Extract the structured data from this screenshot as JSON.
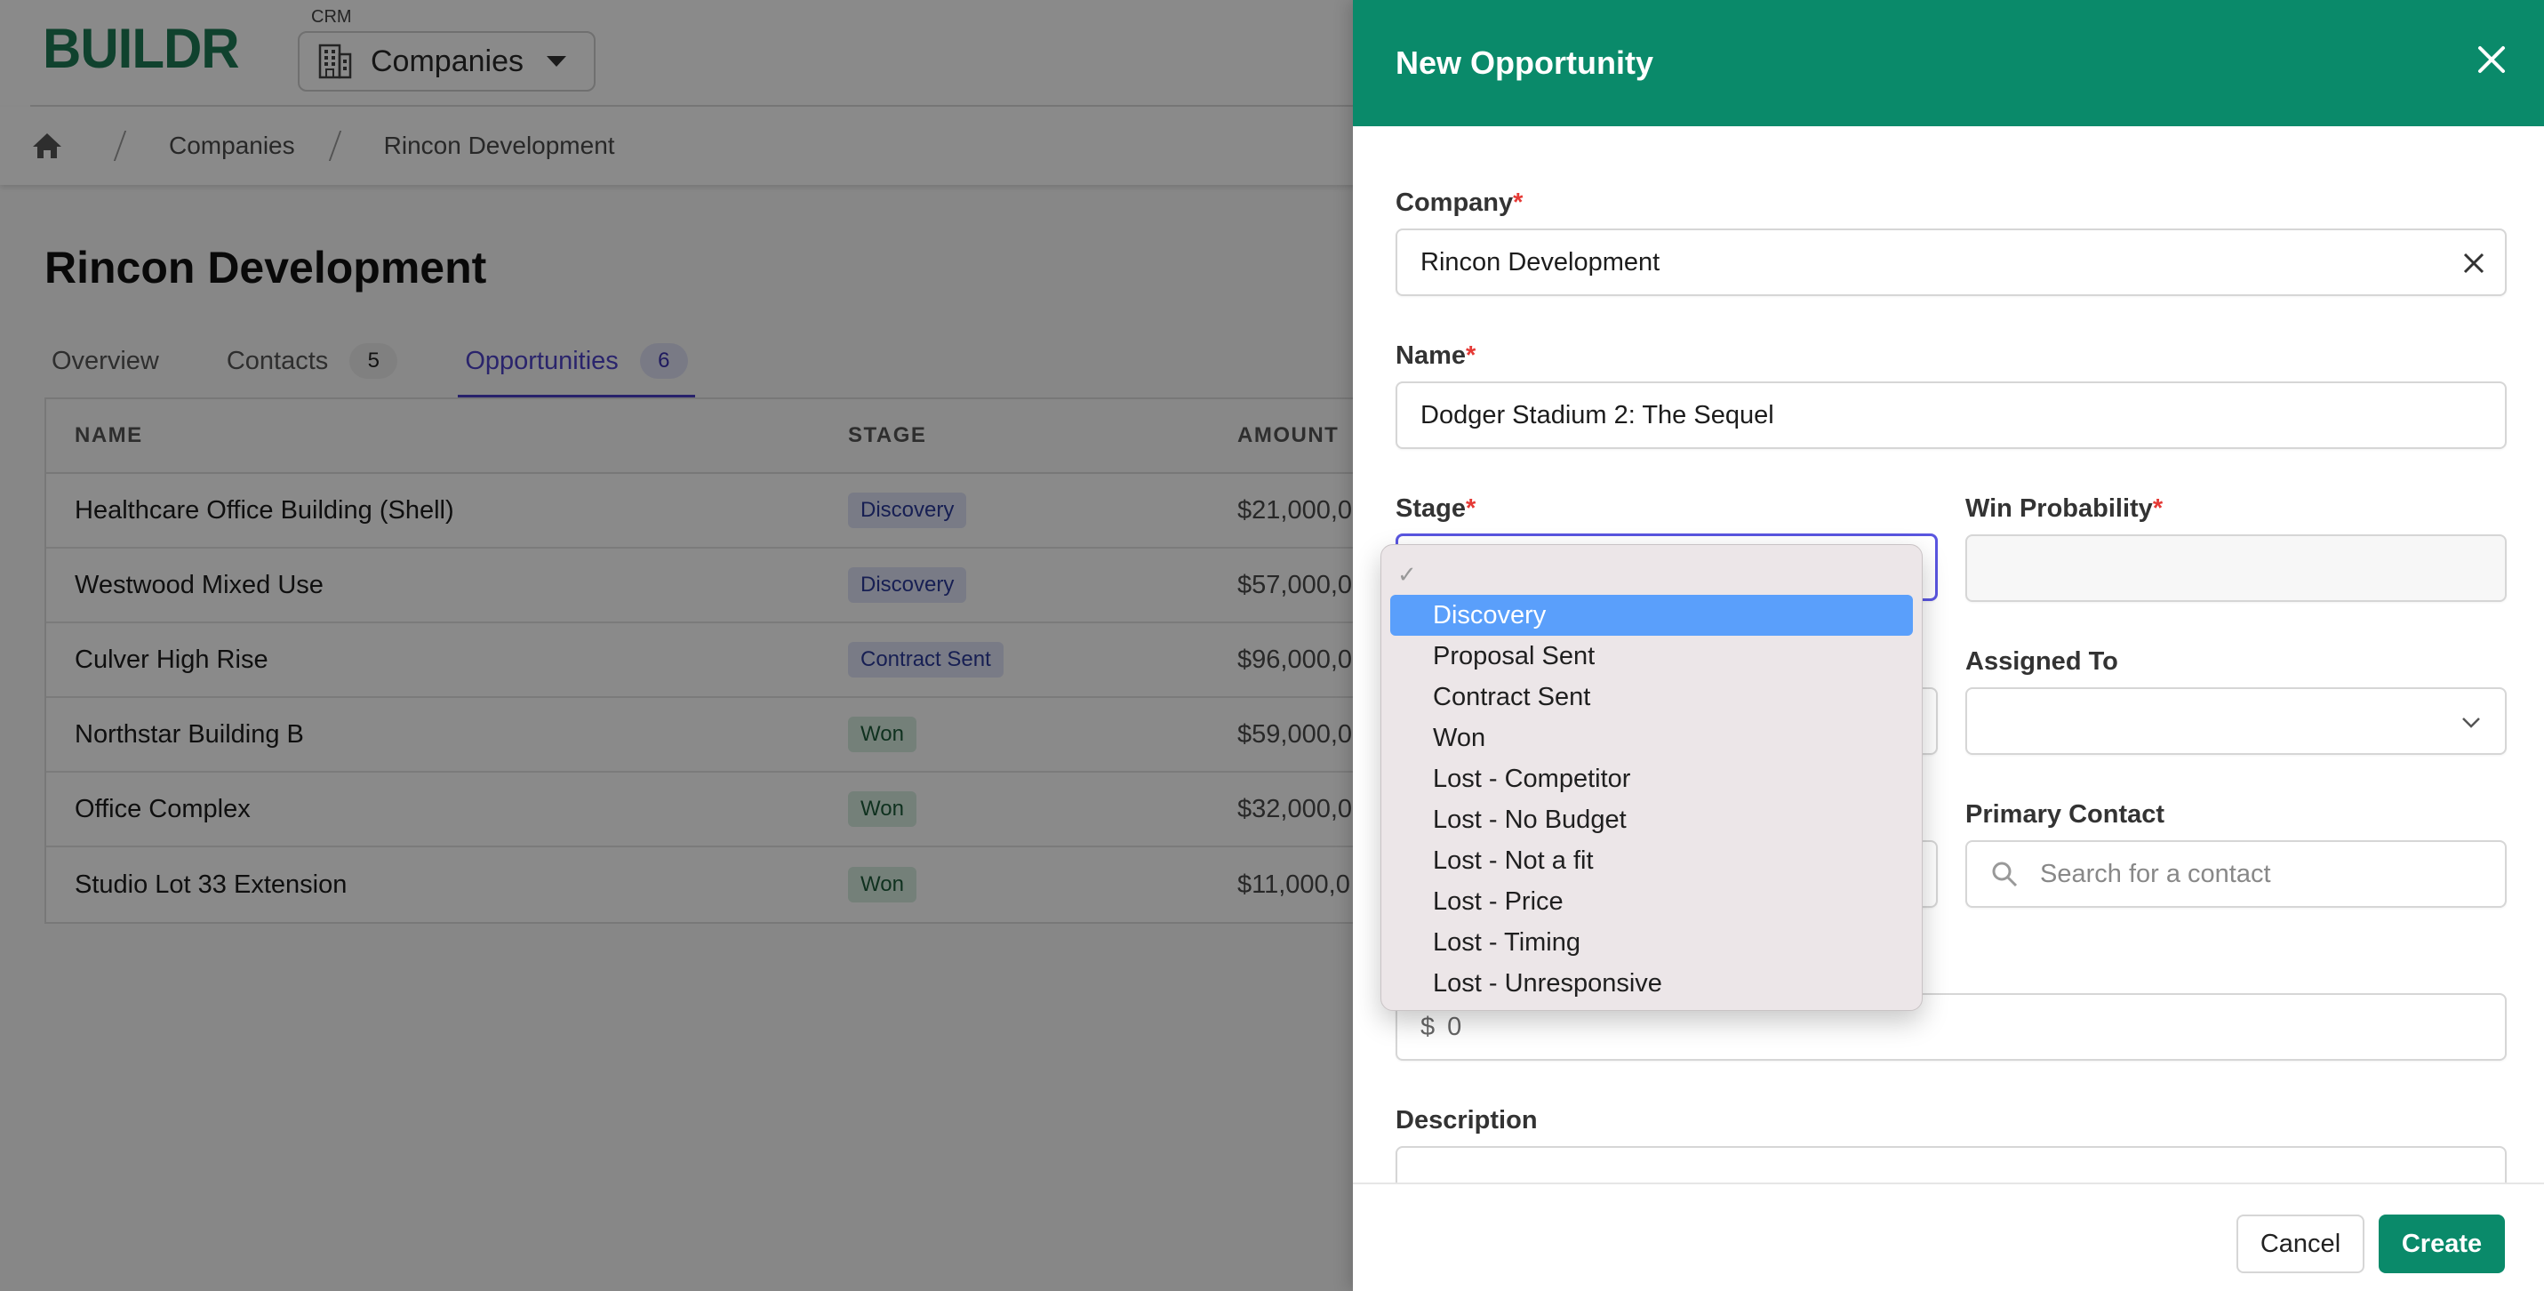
{
  "app": {
    "logo": "BUILDR",
    "section_label": "CRM",
    "module": "Companies",
    "module_icon": "building-icon"
  },
  "breadcrumb": {
    "home_icon": "home-icon",
    "items": [
      "Companies",
      "Rincon Development"
    ]
  },
  "page": {
    "title": "Rincon Development",
    "tabs": [
      {
        "label": "Overview",
        "count": null,
        "active": false
      },
      {
        "label": "Contacts",
        "count": "5",
        "active": false
      },
      {
        "label": "Opportunities",
        "count": "6",
        "active": true
      }
    ]
  },
  "table": {
    "columns": [
      "NAME",
      "STAGE",
      "AMOUNT"
    ],
    "rows": [
      {
        "name": "Healthcare Office Building (Shell)",
        "stage": "Discovery",
        "amount": "$21,000,0"
      },
      {
        "name": "Westwood Mixed Use",
        "stage": "Discovery",
        "amount": "$57,000,0"
      },
      {
        "name": "Culver High Rise",
        "stage": "Contract Sent",
        "amount": "$96,000,0"
      },
      {
        "name": "Northstar Building B",
        "stage": "Won",
        "amount": "$59,000,0"
      },
      {
        "name": "Office Complex",
        "stage": "Won",
        "amount": "$32,000,0"
      },
      {
        "name": "Studio Lot 33 Extension",
        "stage": "Won",
        "amount": "$11,000,0"
      }
    ]
  },
  "drawer": {
    "title": "New Opportunity",
    "close_icon": "close-icon",
    "fields": {
      "company": {
        "label": "Company",
        "required": "*",
        "value": "Rincon Development"
      },
      "name": {
        "label": "Name",
        "required": "*",
        "value": "Dodger Stadium 2: The Sequel"
      },
      "stage": {
        "label": "Stage",
        "required": "*",
        "value": ""
      },
      "win_probability": {
        "label": "Win Probability",
        "required": "*",
        "value": ""
      },
      "assigned_to": {
        "label": "Assigned To",
        "value": ""
      },
      "primary_contact": {
        "label": "Primary Contact",
        "placeholder": "Search for a contact"
      },
      "amount": {
        "prefix": "$",
        "value": "0"
      },
      "description": {
        "label": "Description",
        "value": ""
      }
    },
    "footer": {
      "cancel": "Cancel",
      "create": "Create"
    }
  },
  "stage_dropdown": {
    "check_mark": "✓",
    "highlighted": "Discovery",
    "options": [
      "Discovery",
      "Proposal Sent",
      "Contract Sent",
      "Won",
      "Lost - Competitor",
      "Lost - No Budget",
      "Lost - Not a fit",
      "Lost - Price",
      "Lost - Timing",
      "Lost - Unresponsive"
    ]
  },
  "colors": {
    "brand_green": "#0a8a6a",
    "logo_green": "#1f7a55",
    "accent_purple": "#4f44c8",
    "focus_ring": "#5a56e0",
    "dropdown_highlight": "#5a9ffb",
    "required": "#e53935"
  }
}
